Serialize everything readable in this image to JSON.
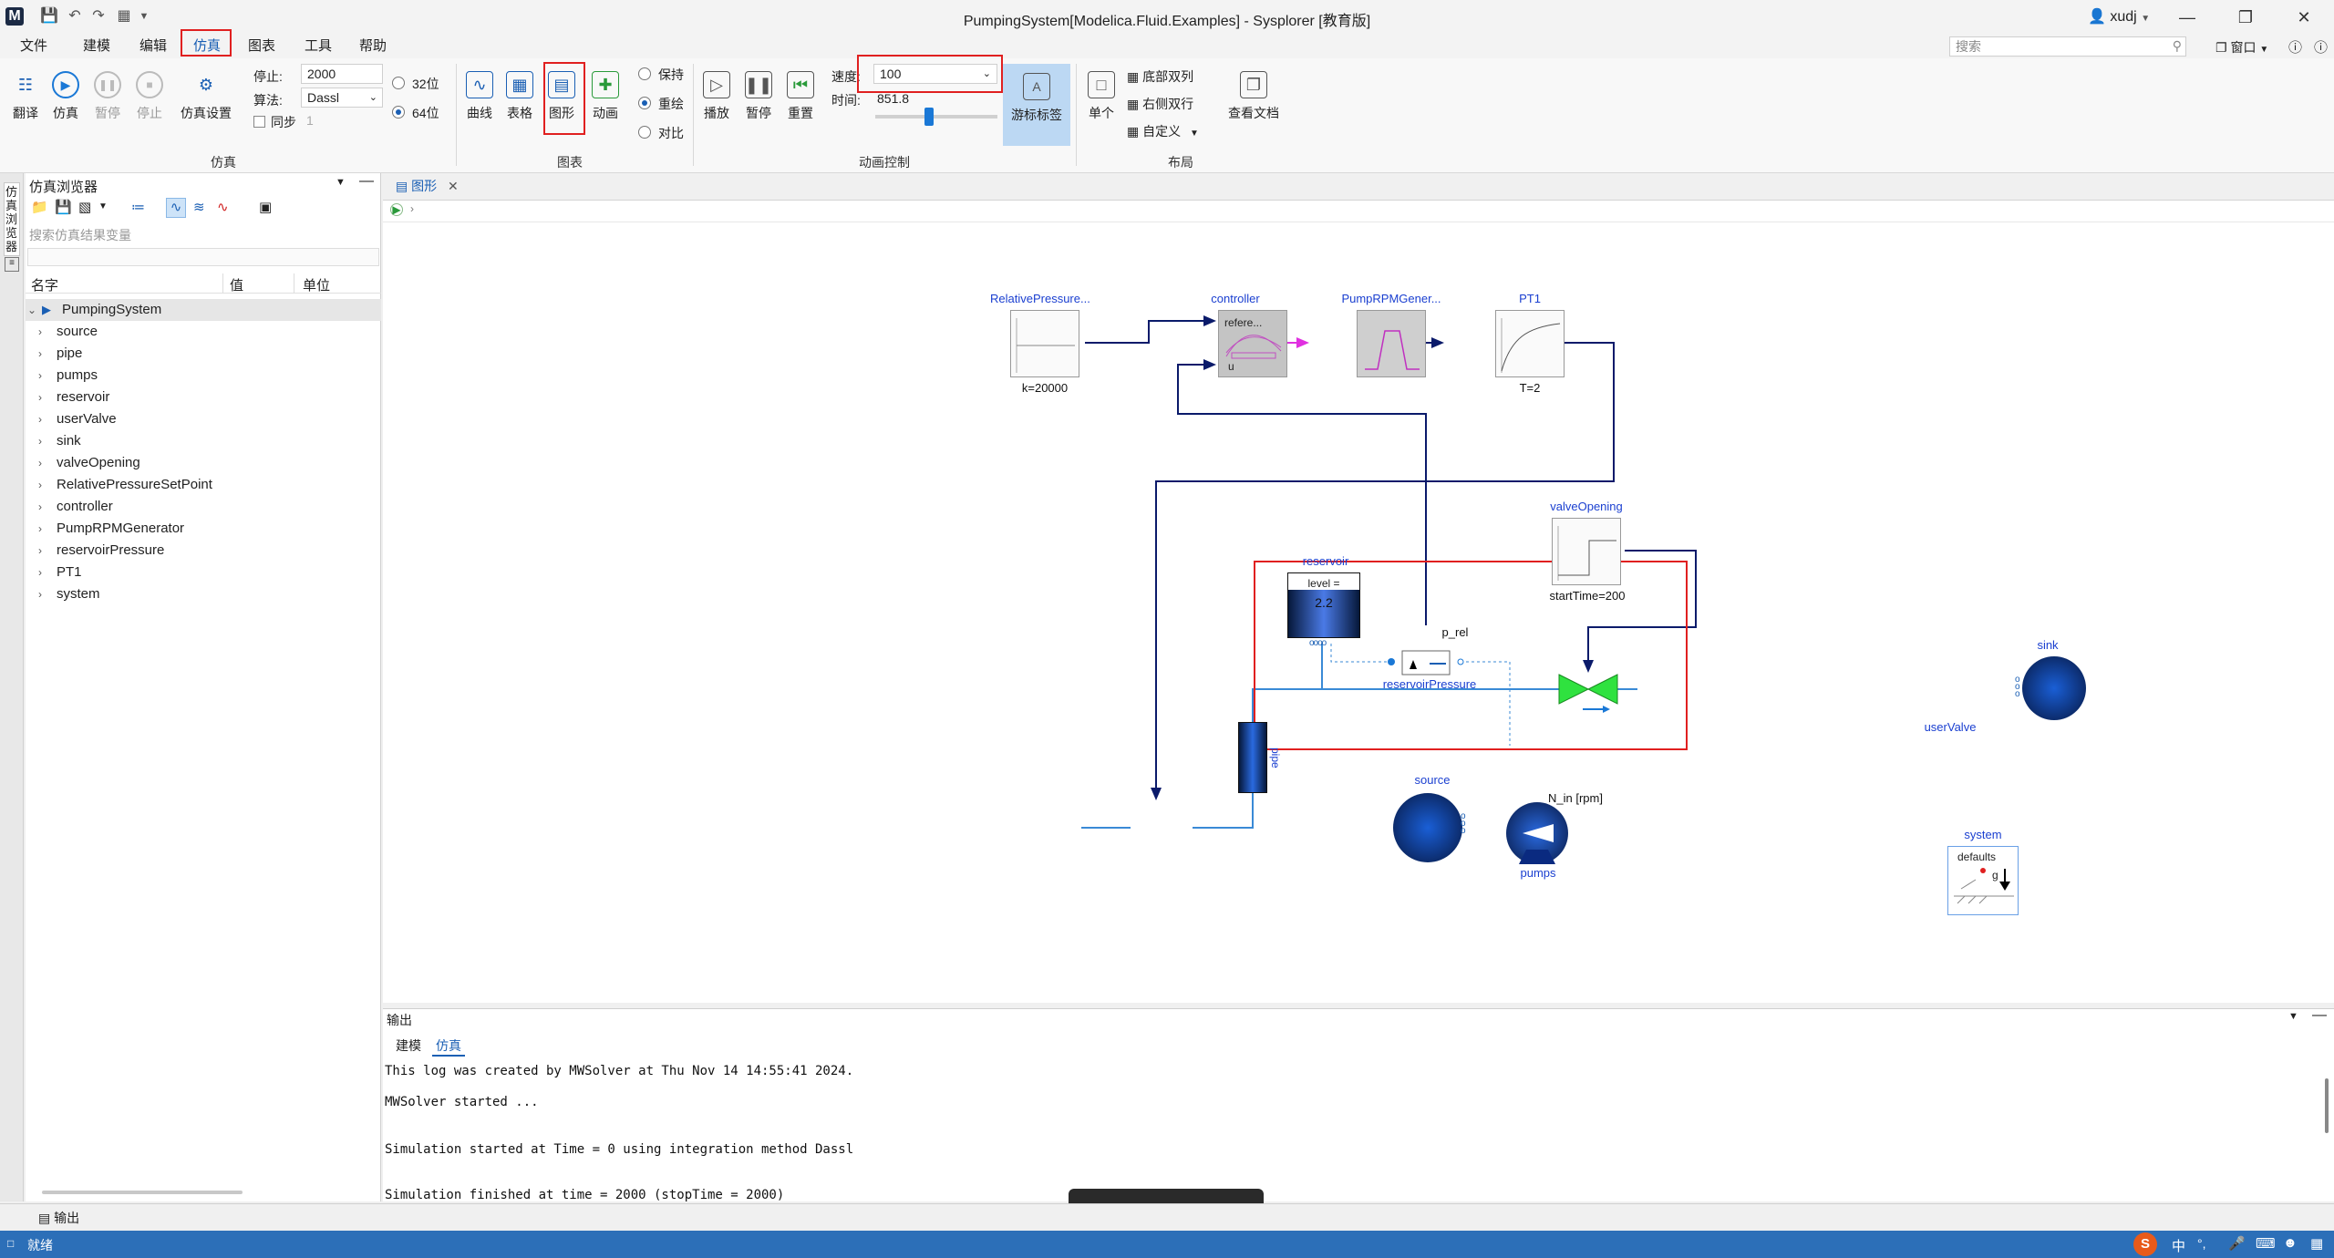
{
  "window": {
    "title": "PumpingSystem[Modelica.Fluid.Examples] - Sysplorer [教育版]",
    "user": "xudj",
    "window_menu": "窗口"
  },
  "search": {
    "placeholder": "搜索"
  },
  "menu": [
    "文件",
    "建模",
    "编辑",
    "仿真",
    "图表",
    "工具",
    "帮助"
  ],
  "ribbon": {
    "sim_buttons": [
      "翻译",
      "仿真",
      "暂停",
      "停止",
      "仿真设置"
    ],
    "stop_label": "停止:",
    "stop_value": "2000",
    "algo_label": "算法:",
    "algo_value": "Dassl",
    "sync_label": "同步",
    "sync_value": "1",
    "bit32": "32位",
    "bit64": "64位",
    "group_sim": "仿真",
    "chart_buttons": [
      "曲线",
      "表格",
      "图形",
      "动画"
    ],
    "radios": [
      "保持",
      "重绘",
      "对比"
    ],
    "group_chart": "图表",
    "anim_buttons": [
      "播放",
      "暂停",
      "重置"
    ],
    "speed_label": "速度:",
    "speed_value": "100",
    "time_label": "时间:",
    "time_value": "851.8",
    "cursor_label": "游标标签",
    "group_anim": "动画控制",
    "single_label": "单个",
    "layout_opts": [
      "底部双列",
      "右侧双行",
      "自定义"
    ],
    "doc_label": "查看文档",
    "group_layout": "布局"
  },
  "browser": {
    "title": "仿真浏览器",
    "side_tab": "仿真浏览器",
    "search_placeholder": "搜索仿真结果变量",
    "cols": [
      "名字",
      "值",
      "单位"
    ],
    "root": "PumpingSystem",
    "items": [
      "source",
      "pipe",
      "pumps",
      "reservoir",
      "userValve",
      "sink",
      "valveOpening",
      "RelativePressureSetPoint",
      "controller",
      "PumpRPMGenerator",
      "reservoirPressure",
      "PT1",
      "system"
    ]
  },
  "tab": {
    "label": "图形"
  },
  "diagram": {
    "rel_name": "RelativePressure...",
    "rel_param": "k=20000",
    "ctrl_name": "controller",
    "ctrl_in1": "refere...",
    "ctrl_in2": "u",
    "rpm_name": "PumpRPMGener...",
    "pt1_name": "PT1",
    "pt1_param": "T=2",
    "vo_name": "valveOpening",
    "vo_param": "startTime=200",
    "res_name": "reservoir",
    "res_level": "level =",
    "res_value": "2.2",
    "prel": "p_rel",
    "rp_name": "reservoirPressure",
    "sink_name": "sink",
    "uv_name": "userValve",
    "pipe_label": "pipe",
    "src_name": "source",
    "pump_name": "pumps",
    "pump_in": "N_in [rpm]",
    "sys_name": "system",
    "sys_defaults": "defaults",
    "sys_g": "g"
  },
  "output": {
    "title": "输出",
    "tabs": [
      "建模",
      "仿真"
    ],
    "lines": [
      "This log was created by MWSolver at Thu Nov 14 14:55:41 2024.",
      "MWSolver started ...",
      "Simulation started at Time = 0 using integration method Dassl",
      "Simulation finished at time = 2000 (stopTime = 2000)"
    ]
  },
  "bottom": {
    "tab": "输出"
  },
  "status": {
    "text": "就绪",
    "ime": "中"
  }
}
